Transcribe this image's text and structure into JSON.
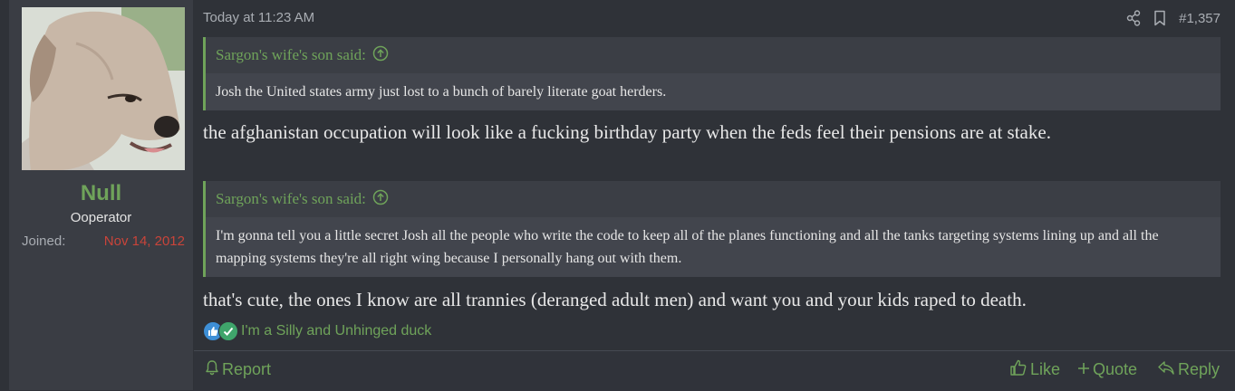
{
  "user": {
    "name": "Null",
    "title": "Ooperator",
    "joined_label": "Joined:",
    "joined_value": "Nov 14, 2012"
  },
  "post": {
    "date": "Today at 11:23 AM",
    "number": "#1,357",
    "quotes": [
      {
        "author": "Sargon's wife's son said:",
        "text": "Josh the United states army just lost to a bunch of barely literate goat herders."
      },
      {
        "author": "Sargon's wife's son said:",
        "text": "I'm gonna tell you a little secret Josh all the people who write the code to keep all of the planes functioning and all the tanks targeting systems lining up and all the mapping systems they're all right wing because I personally hang out with them."
      }
    ],
    "replies": [
      "the afghanistan occupation will look like a fucking birthday party when the feds feel their pensions are at stake.",
      "that's cute, the ones I know are all trannies (deranged adult men) and want you and your kids raped to death."
    ],
    "reaction_summary": "I'm a Silly and Unhinged duck"
  },
  "footer": {
    "report": "Report",
    "like": "Like",
    "quote": "Quote",
    "reply": "Reply"
  },
  "colors": {
    "accent": "#6fa35a",
    "joined_date": "#c9443a",
    "background": "#2f3238",
    "sidebar": "#3a3d44"
  },
  "icons": [
    "share-icon",
    "bookmark-icon",
    "arrow-up-circle-icon",
    "like-reaction-icon",
    "check-reaction-icon",
    "bell-icon",
    "thumbs-up-icon",
    "plus-icon",
    "reply-icon"
  ]
}
